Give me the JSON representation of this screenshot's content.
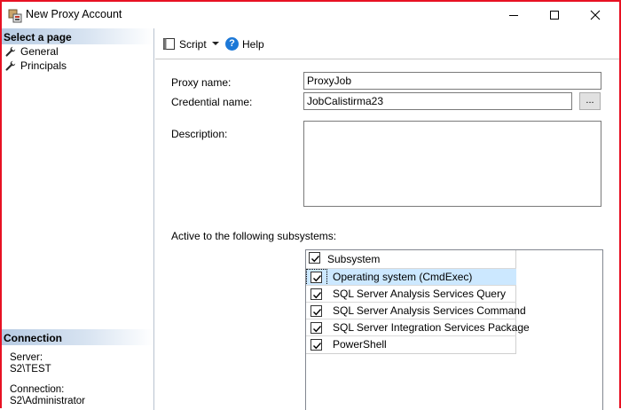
{
  "window": {
    "title": "New Proxy Account"
  },
  "left_pane": {
    "select_page_header": "Select a page",
    "pages": [
      {
        "label": "General"
      },
      {
        "label": "Principals"
      }
    ],
    "connection_header": "Connection",
    "server_label": "Server:",
    "server_value": "S2\\TEST",
    "connection_label": "Connection:",
    "connection_value": "S2\\Administrator"
  },
  "toolbar": {
    "script_label": "Script",
    "help_label": "Help"
  },
  "form": {
    "proxy_name_label": "Proxy name:",
    "proxy_name_value": "ProxyJob",
    "credential_name_label": "Credential name:",
    "credential_name_value": "JobCalistirma23",
    "browse_label": "...",
    "description_label": "Description:",
    "description_value": "",
    "subsystems_label": "Active to the following subsystems:"
  },
  "subsystems": {
    "header": "Subsystem",
    "header_checked": true,
    "rows": [
      {
        "label": "Operating system (CmdExec)",
        "checked": true,
        "selected": true
      },
      {
        "label": "SQL Server Analysis Services Query",
        "checked": true,
        "selected": false
      },
      {
        "label": "SQL Server Analysis Services Command",
        "checked": true,
        "selected": false
      },
      {
        "label": "SQL Server Integration Services Package",
        "checked": true,
        "selected": false
      },
      {
        "label": "PowerShell",
        "checked": true,
        "selected": false
      }
    ]
  },
  "colors": {
    "window_border": "#e81123",
    "selection": "#cce8ff",
    "help_icon": "#1c78d7"
  }
}
